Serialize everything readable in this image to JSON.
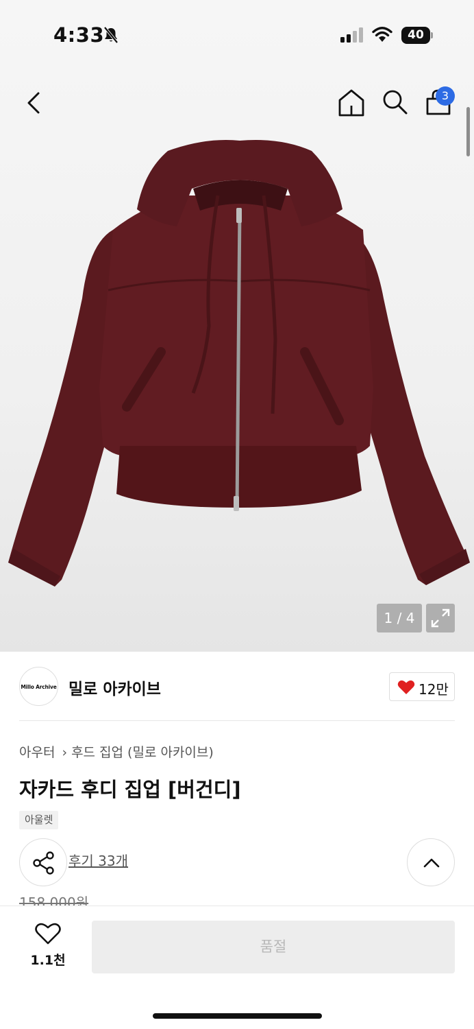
{
  "status_bar": {
    "time": "4:33",
    "battery": "40"
  },
  "nav": {
    "cart_count": "3"
  },
  "gallery": {
    "counter": "1 / 4"
  },
  "brand": {
    "logo_text": "Millo Archive",
    "name": "밀로 아카이브",
    "likes": "12만"
  },
  "product": {
    "breadcrumb": [
      "아우터",
      "후드 집업 (밀로 아카이브)"
    ],
    "title": "자카드 후디 집업 [버건디]",
    "tag": "아울렛",
    "reviews": "후기 33개",
    "original_price": "158,000원"
  },
  "bottom": {
    "wish_count": "1.1천",
    "soldout_label": "품절"
  },
  "colors": {
    "accent": "#2d6be4",
    "heart": "#e02020",
    "garment": "#5b1a1f"
  },
  "icons": [
    "bell-off-icon",
    "signal-icon",
    "wifi-icon",
    "battery-icon",
    "back-icon",
    "home-icon",
    "search-icon",
    "bag-icon",
    "expand-icon",
    "heart-icon",
    "share-icon",
    "chevron-up-icon"
  ]
}
